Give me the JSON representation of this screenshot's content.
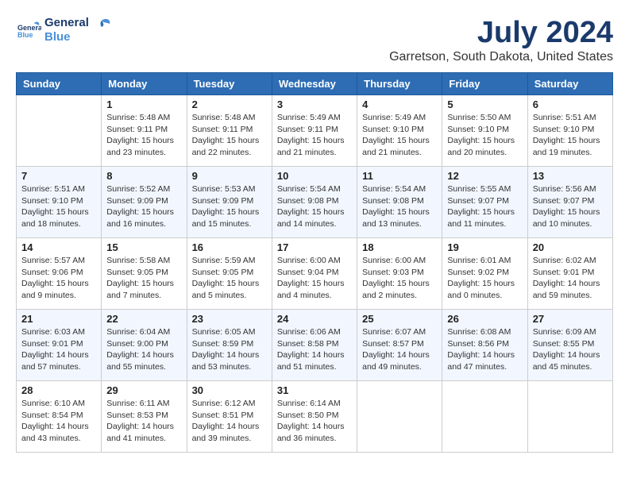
{
  "header": {
    "logo_line1": "General",
    "logo_line2": "Blue",
    "main_title": "July 2024",
    "subtitle": "Garretson, South Dakota, United States"
  },
  "calendar": {
    "days_of_week": [
      "Sunday",
      "Monday",
      "Tuesday",
      "Wednesday",
      "Thursday",
      "Friday",
      "Saturday"
    ],
    "weeks": [
      [
        {
          "day": "",
          "info": ""
        },
        {
          "day": "1",
          "info": "Sunrise: 5:48 AM\nSunset: 9:11 PM\nDaylight: 15 hours\nand 23 minutes."
        },
        {
          "day": "2",
          "info": "Sunrise: 5:48 AM\nSunset: 9:11 PM\nDaylight: 15 hours\nand 22 minutes."
        },
        {
          "day": "3",
          "info": "Sunrise: 5:49 AM\nSunset: 9:11 PM\nDaylight: 15 hours\nand 21 minutes."
        },
        {
          "day": "4",
          "info": "Sunrise: 5:49 AM\nSunset: 9:10 PM\nDaylight: 15 hours\nand 21 minutes."
        },
        {
          "day": "5",
          "info": "Sunrise: 5:50 AM\nSunset: 9:10 PM\nDaylight: 15 hours\nand 20 minutes."
        },
        {
          "day": "6",
          "info": "Sunrise: 5:51 AM\nSunset: 9:10 PM\nDaylight: 15 hours\nand 19 minutes."
        }
      ],
      [
        {
          "day": "7",
          "info": "Sunrise: 5:51 AM\nSunset: 9:10 PM\nDaylight: 15 hours\nand 18 minutes."
        },
        {
          "day": "8",
          "info": "Sunrise: 5:52 AM\nSunset: 9:09 PM\nDaylight: 15 hours\nand 16 minutes."
        },
        {
          "day": "9",
          "info": "Sunrise: 5:53 AM\nSunset: 9:09 PM\nDaylight: 15 hours\nand 15 minutes."
        },
        {
          "day": "10",
          "info": "Sunrise: 5:54 AM\nSunset: 9:08 PM\nDaylight: 15 hours\nand 14 minutes."
        },
        {
          "day": "11",
          "info": "Sunrise: 5:54 AM\nSunset: 9:08 PM\nDaylight: 15 hours\nand 13 minutes."
        },
        {
          "day": "12",
          "info": "Sunrise: 5:55 AM\nSunset: 9:07 PM\nDaylight: 15 hours\nand 11 minutes."
        },
        {
          "day": "13",
          "info": "Sunrise: 5:56 AM\nSunset: 9:07 PM\nDaylight: 15 hours\nand 10 minutes."
        }
      ],
      [
        {
          "day": "14",
          "info": "Sunrise: 5:57 AM\nSunset: 9:06 PM\nDaylight: 15 hours\nand 9 minutes."
        },
        {
          "day": "15",
          "info": "Sunrise: 5:58 AM\nSunset: 9:05 PM\nDaylight: 15 hours\nand 7 minutes."
        },
        {
          "day": "16",
          "info": "Sunrise: 5:59 AM\nSunset: 9:05 PM\nDaylight: 15 hours\nand 5 minutes."
        },
        {
          "day": "17",
          "info": "Sunrise: 6:00 AM\nSunset: 9:04 PM\nDaylight: 15 hours\nand 4 minutes."
        },
        {
          "day": "18",
          "info": "Sunrise: 6:00 AM\nSunset: 9:03 PM\nDaylight: 15 hours\nand 2 minutes."
        },
        {
          "day": "19",
          "info": "Sunrise: 6:01 AM\nSunset: 9:02 PM\nDaylight: 15 hours\nand 0 minutes."
        },
        {
          "day": "20",
          "info": "Sunrise: 6:02 AM\nSunset: 9:01 PM\nDaylight: 14 hours\nand 59 minutes."
        }
      ],
      [
        {
          "day": "21",
          "info": "Sunrise: 6:03 AM\nSunset: 9:01 PM\nDaylight: 14 hours\nand 57 minutes."
        },
        {
          "day": "22",
          "info": "Sunrise: 6:04 AM\nSunset: 9:00 PM\nDaylight: 14 hours\nand 55 minutes."
        },
        {
          "day": "23",
          "info": "Sunrise: 6:05 AM\nSunset: 8:59 PM\nDaylight: 14 hours\nand 53 minutes."
        },
        {
          "day": "24",
          "info": "Sunrise: 6:06 AM\nSunset: 8:58 PM\nDaylight: 14 hours\nand 51 minutes."
        },
        {
          "day": "25",
          "info": "Sunrise: 6:07 AM\nSunset: 8:57 PM\nDaylight: 14 hours\nand 49 minutes."
        },
        {
          "day": "26",
          "info": "Sunrise: 6:08 AM\nSunset: 8:56 PM\nDaylight: 14 hours\nand 47 minutes."
        },
        {
          "day": "27",
          "info": "Sunrise: 6:09 AM\nSunset: 8:55 PM\nDaylight: 14 hours\nand 45 minutes."
        }
      ],
      [
        {
          "day": "28",
          "info": "Sunrise: 6:10 AM\nSunset: 8:54 PM\nDaylight: 14 hours\nand 43 minutes."
        },
        {
          "day": "29",
          "info": "Sunrise: 6:11 AM\nSunset: 8:53 PM\nDaylight: 14 hours\nand 41 minutes."
        },
        {
          "day": "30",
          "info": "Sunrise: 6:12 AM\nSunset: 8:51 PM\nDaylight: 14 hours\nand 39 minutes."
        },
        {
          "day": "31",
          "info": "Sunrise: 6:14 AM\nSunset: 8:50 PM\nDaylight: 14 hours\nand 36 minutes."
        },
        {
          "day": "",
          "info": ""
        },
        {
          "day": "",
          "info": ""
        },
        {
          "day": "",
          "info": ""
        }
      ]
    ]
  }
}
